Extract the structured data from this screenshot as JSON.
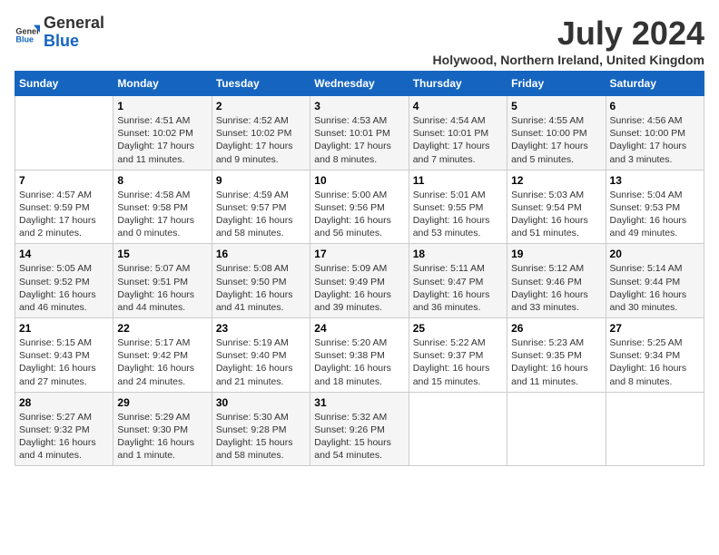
{
  "header": {
    "logo_general": "General",
    "logo_blue": "Blue",
    "month_title": "July 2024",
    "location": "Holywood, Northern Ireland, United Kingdom"
  },
  "days_of_week": [
    "Sunday",
    "Monday",
    "Tuesday",
    "Wednesday",
    "Thursday",
    "Friday",
    "Saturday"
  ],
  "weeks": [
    [
      {
        "day": "",
        "content": ""
      },
      {
        "day": "1",
        "content": "Sunrise: 4:51 AM\nSunset: 10:02 PM\nDaylight: 17 hours\nand 11 minutes."
      },
      {
        "day": "2",
        "content": "Sunrise: 4:52 AM\nSunset: 10:02 PM\nDaylight: 17 hours\nand 9 minutes."
      },
      {
        "day": "3",
        "content": "Sunrise: 4:53 AM\nSunset: 10:01 PM\nDaylight: 17 hours\nand 8 minutes."
      },
      {
        "day": "4",
        "content": "Sunrise: 4:54 AM\nSunset: 10:01 PM\nDaylight: 17 hours\nand 7 minutes."
      },
      {
        "day": "5",
        "content": "Sunrise: 4:55 AM\nSunset: 10:00 PM\nDaylight: 17 hours\nand 5 minutes."
      },
      {
        "day": "6",
        "content": "Sunrise: 4:56 AM\nSunset: 10:00 PM\nDaylight: 17 hours\nand 3 minutes."
      }
    ],
    [
      {
        "day": "7",
        "content": "Sunrise: 4:57 AM\nSunset: 9:59 PM\nDaylight: 17 hours\nand 2 minutes."
      },
      {
        "day": "8",
        "content": "Sunrise: 4:58 AM\nSunset: 9:58 PM\nDaylight: 17 hours\nand 0 minutes."
      },
      {
        "day": "9",
        "content": "Sunrise: 4:59 AM\nSunset: 9:57 PM\nDaylight: 16 hours\nand 58 minutes."
      },
      {
        "day": "10",
        "content": "Sunrise: 5:00 AM\nSunset: 9:56 PM\nDaylight: 16 hours\nand 56 minutes."
      },
      {
        "day": "11",
        "content": "Sunrise: 5:01 AM\nSunset: 9:55 PM\nDaylight: 16 hours\nand 53 minutes."
      },
      {
        "day": "12",
        "content": "Sunrise: 5:03 AM\nSunset: 9:54 PM\nDaylight: 16 hours\nand 51 minutes."
      },
      {
        "day": "13",
        "content": "Sunrise: 5:04 AM\nSunset: 9:53 PM\nDaylight: 16 hours\nand 49 minutes."
      }
    ],
    [
      {
        "day": "14",
        "content": "Sunrise: 5:05 AM\nSunset: 9:52 PM\nDaylight: 16 hours\nand 46 minutes."
      },
      {
        "day": "15",
        "content": "Sunrise: 5:07 AM\nSunset: 9:51 PM\nDaylight: 16 hours\nand 44 minutes."
      },
      {
        "day": "16",
        "content": "Sunrise: 5:08 AM\nSunset: 9:50 PM\nDaylight: 16 hours\nand 41 minutes."
      },
      {
        "day": "17",
        "content": "Sunrise: 5:09 AM\nSunset: 9:49 PM\nDaylight: 16 hours\nand 39 minutes."
      },
      {
        "day": "18",
        "content": "Sunrise: 5:11 AM\nSunset: 9:47 PM\nDaylight: 16 hours\nand 36 minutes."
      },
      {
        "day": "19",
        "content": "Sunrise: 5:12 AM\nSunset: 9:46 PM\nDaylight: 16 hours\nand 33 minutes."
      },
      {
        "day": "20",
        "content": "Sunrise: 5:14 AM\nSunset: 9:44 PM\nDaylight: 16 hours\nand 30 minutes."
      }
    ],
    [
      {
        "day": "21",
        "content": "Sunrise: 5:15 AM\nSunset: 9:43 PM\nDaylight: 16 hours\nand 27 minutes."
      },
      {
        "day": "22",
        "content": "Sunrise: 5:17 AM\nSunset: 9:42 PM\nDaylight: 16 hours\nand 24 minutes."
      },
      {
        "day": "23",
        "content": "Sunrise: 5:19 AM\nSunset: 9:40 PM\nDaylight: 16 hours\nand 21 minutes."
      },
      {
        "day": "24",
        "content": "Sunrise: 5:20 AM\nSunset: 9:38 PM\nDaylight: 16 hours\nand 18 minutes."
      },
      {
        "day": "25",
        "content": "Sunrise: 5:22 AM\nSunset: 9:37 PM\nDaylight: 16 hours\nand 15 minutes."
      },
      {
        "day": "26",
        "content": "Sunrise: 5:23 AM\nSunset: 9:35 PM\nDaylight: 16 hours\nand 11 minutes."
      },
      {
        "day": "27",
        "content": "Sunrise: 5:25 AM\nSunset: 9:34 PM\nDaylight: 16 hours\nand 8 minutes."
      }
    ],
    [
      {
        "day": "28",
        "content": "Sunrise: 5:27 AM\nSunset: 9:32 PM\nDaylight: 16 hours\nand 4 minutes."
      },
      {
        "day": "29",
        "content": "Sunrise: 5:29 AM\nSunset: 9:30 PM\nDaylight: 16 hours\nand 1 minute."
      },
      {
        "day": "30",
        "content": "Sunrise: 5:30 AM\nSunset: 9:28 PM\nDaylight: 15 hours\nand 58 minutes."
      },
      {
        "day": "31",
        "content": "Sunrise: 5:32 AM\nSunset: 9:26 PM\nDaylight: 15 hours\nand 54 minutes."
      },
      {
        "day": "",
        "content": ""
      },
      {
        "day": "",
        "content": ""
      },
      {
        "day": "",
        "content": ""
      }
    ]
  ]
}
